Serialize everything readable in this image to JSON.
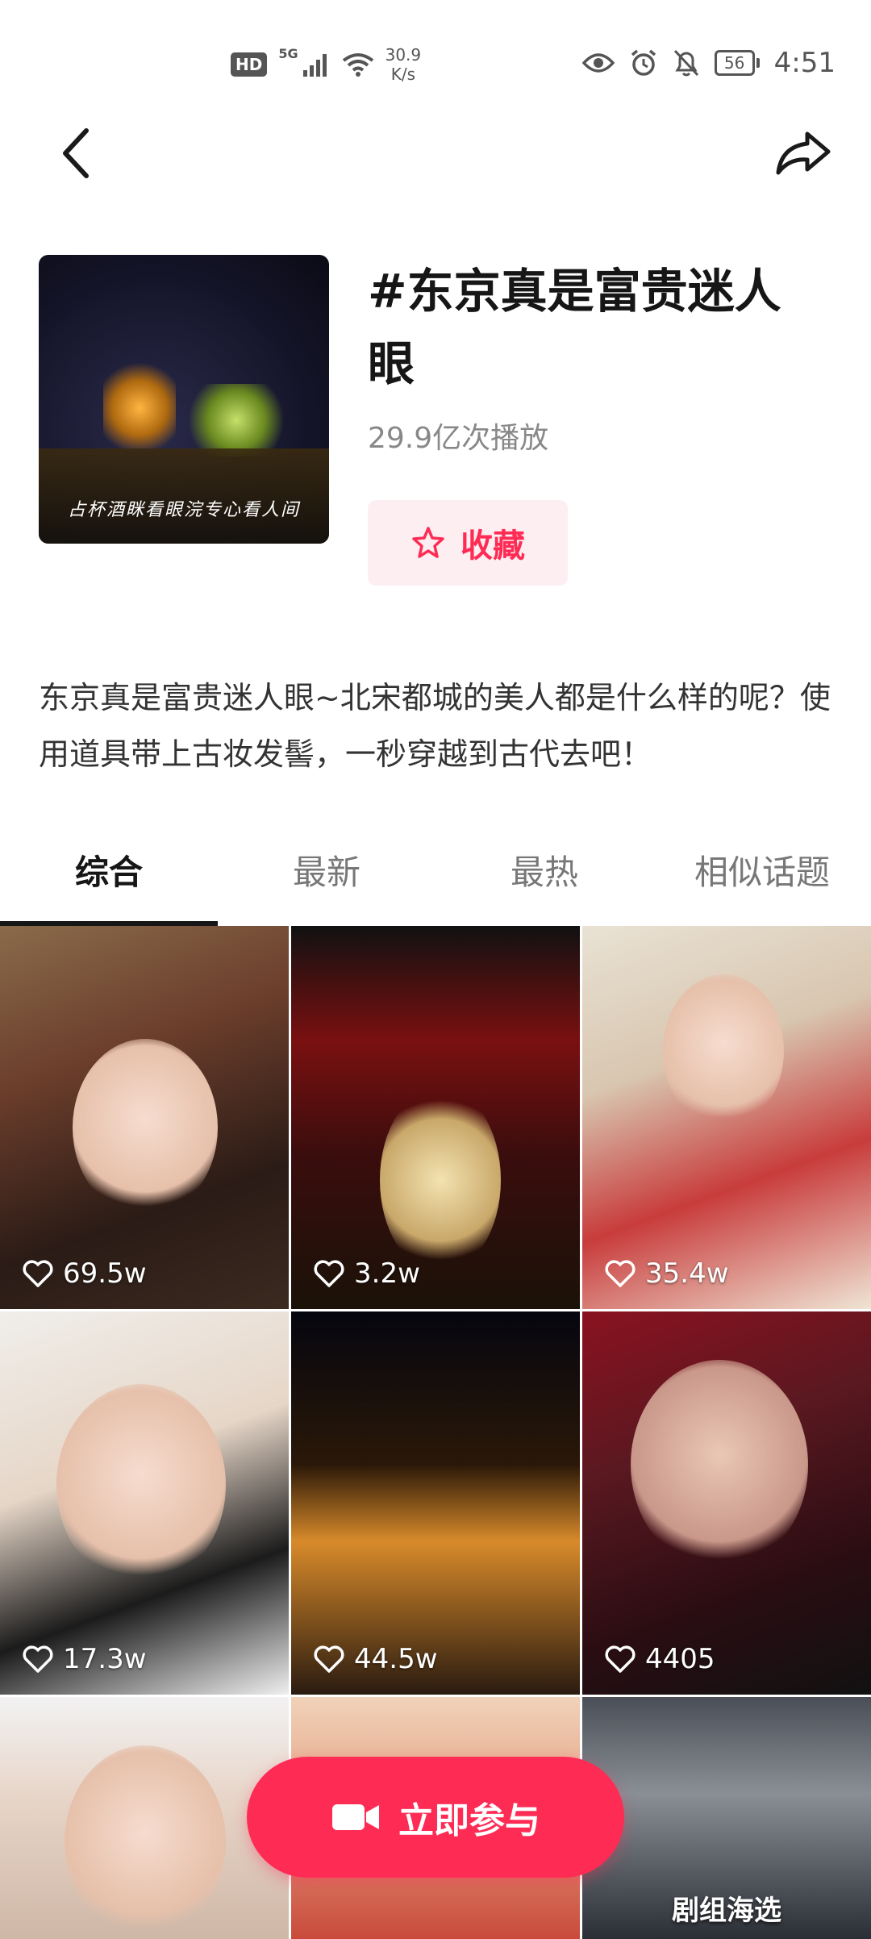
{
  "status_bar": {
    "hd": "HD",
    "network": "5G",
    "net_speed_value": "30.9",
    "net_speed_unit": "K/s",
    "battery": "56",
    "time": "4:51"
  },
  "header": {
    "back_icon": "chevron-left-icon",
    "share_icon": "share-arrow-icon"
  },
  "topic": {
    "title": "#东京真是富贵迷人眼",
    "plays": "29.9亿次播放",
    "cover_caption": "占杯酒眯看眼浣专心看人间",
    "favorite_label": "收藏"
  },
  "description": "东京真是富贵迷人眼~北宋都城的美人都是什么样的呢？使用道具带上古妆发髻，一秒穿越到古代去吧！",
  "tabs": [
    "综合",
    "最新",
    "最热",
    "相似话题"
  ],
  "active_tab": "综合",
  "videos": [
    {
      "likes": "69.5w"
    },
    {
      "likes": "3.2w"
    },
    {
      "likes": "35.4w"
    },
    {
      "likes": "17.3w"
    },
    {
      "likes": "44.5w"
    },
    {
      "likes": "4405"
    },
    {
      "overlay": ""
    },
    {
      "overlay": ""
    },
    {
      "overlay": "剧组海选"
    }
  ],
  "join_button": {
    "label": "立即参与",
    "icon": "video-camera-icon"
  },
  "colors": {
    "accent": "#fe2c55",
    "accent_soft": "#fdeef1",
    "text_primary": "#161616",
    "text_secondary": "#888888"
  }
}
